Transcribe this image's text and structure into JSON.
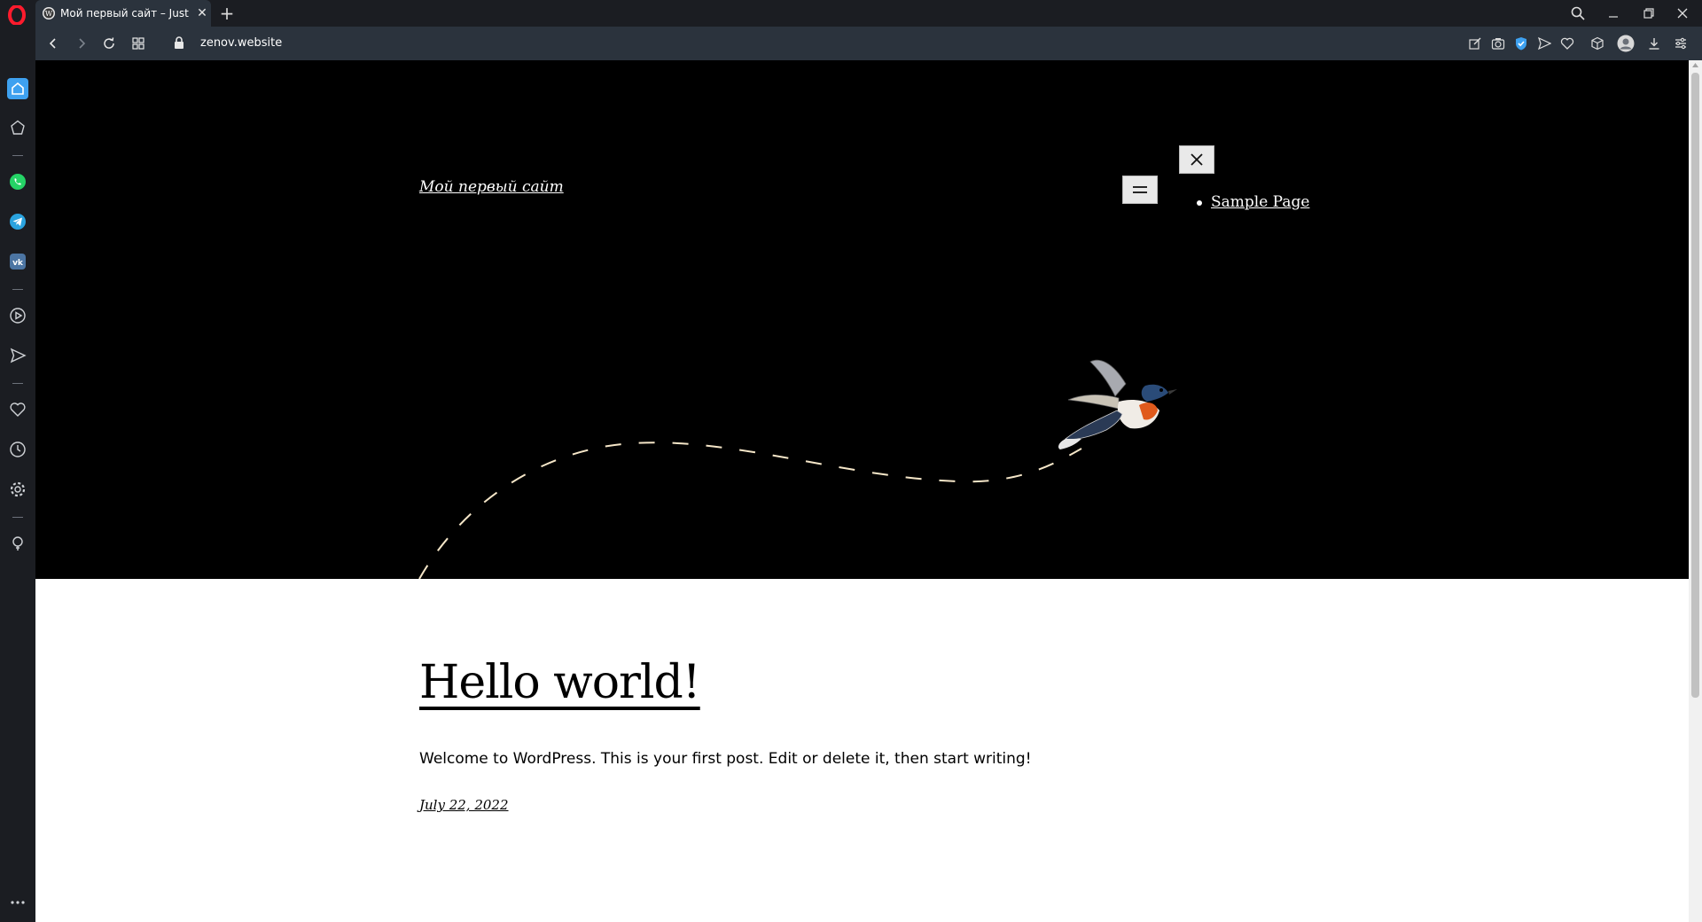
{
  "browser": {
    "tab_title": "Мой первый сайт – Just another WordPress site",
    "url": "zenov.website",
    "new_tab_symbol": "+",
    "tab_close_symbol": "✕"
  },
  "site": {
    "title": "Мой первый сайт",
    "nav_items": [
      "Sample Page"
    ]
  },
  "post": {
    "title": "Hello world!",
    "body": "Welcome to WordPress. This is your first post. Edit or delete it, then start writing!",
    "date": "July 22, 2022"
  },
  "colors": {
    "opera_red": "#ff1b2d",
    "chrome_dark": "#1b1d22",
    "chrome_bar": "#2b333d",
    "whatsapp_green": "#25d366",
    "telegram_blue": "#2aa3df",
    "vk_blue": "#4c75a3",
    "hero_bg": "#000000",
    "dash_cream": "#f5e6c8"
  },
  "icons": {
    "sidebar": [
      "home-icon",
      "speed-dial-icon",
      "whatsapp-icon",
      "telegram-icon",
      "vk-icon",
      "player-icon",
      "flow-icon",
      "heart-icon",
      "history-icon",
      "settings-icon",
      "lightbulb-icon",
      "more-icon"
    ],
    "toolbar": [
      "edit-icon",
      "camera-icon",
      "shield-icon",
      "send-icon",
      "heart-icon",
      "cube-icon",
      "profile-icon",
      "download-icon",
      "menu-icon"
    ]
  }
}
